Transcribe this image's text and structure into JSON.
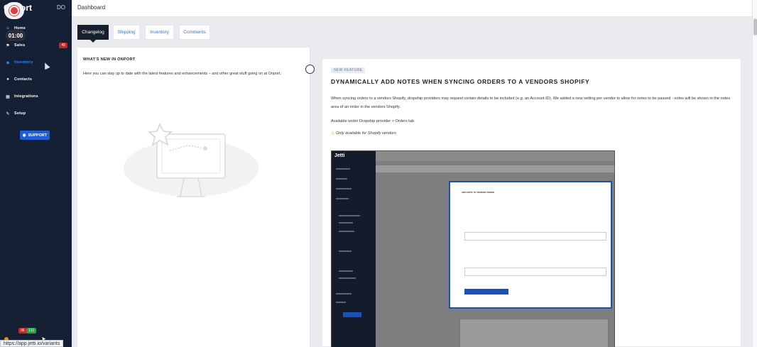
{
  "app": {
    "logo_text": "Onport",
    "user_initials": "DO",
    "url_status": "https://app.jetti.io/variants"
  },
  "recorder": {
    "timer": "01:00"
  },
  "sidebar": {
    "items": [
      {
        "label": "Home",
        "icon": "home-icon"
      },
      {
        "label": "Sales",
        "icon": "flag-icon",
        "badge": "45"
      },
      {
        "label": "Inventory",
        "icon": "tag-icon",
        "active": true
      },
      {
        "label": "Contacts",
        "icon": "user-icon"
      },
      {
        "label": "Integrations",
        "icon": "grid-icon"
      },
      {
        "label": "Setup",
        "icon": "wrench-icon"
      }
    ],
    "support_label": "SUPPORT",
    "bottom_badge_red": "96",
    "bottom_badge_green": "131"
  },
  "topbar": {
    "title": "Dashboard"
  },
  "tabs": [
    {
      "label": "Changelog",
      "active": true
    },
    {
      "label": "Shipping"
    },
    {
      "label": "Inventory"
    },
    {
      "label": "Comments"
    }
  ],
  "whats_new": {
    "heading": "WHAT'S NEW IN ONPORT",
    "description": "Here you can stay up to date with the latest features and enhancements – and other great stuff going on at Onport."
  },
  "feature": {
    "tag": "NEW FEATURE",
    "title": "DYNAMICALLY ADD NOTES WHEN SYNCING ORDERS TO A VENDORS SHOPIFY",
    "paragraph1": "When syncing orders to a vendors Shopify, dropship providers may request certain details to be included (e.g. an Account ID). We added a new setting per vendor to allow for notes to be passed - notes will be shown in the notes area of an order in the vendors Shopify.",
    "paragraph2": "Available under Dropship provider > Orders tab",
    "paragraph3": "Only available for Shopify vendors"
  },
  "embedded_screenshot": {
    "brand": "Jetti",
    "modal_title": "ADD NOTE TO VENDOR ORDER"
  },
  "colors": {
    "sidebar_bg": "#152034",
    "accent": "#1f5ed6",
    "active_nav": "#3b82f6",
    "badge_red": "#c62828",
    "badge_green": "#2e9e4a"
  }
}
